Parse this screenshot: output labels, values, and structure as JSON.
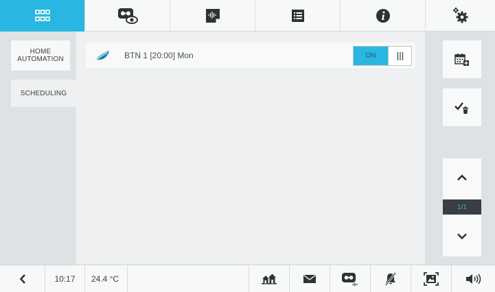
{
  "topbar": {
    "tabs": [
      {
        "icon": "grid-apps-icon",
        "active": true
      },
      {
        "icon": "video-eye-icon",
        "active": false
      },
      {
        "icon": "audio-memo-icon",
        "active": false
      },
      {
        "icon": "list-icon",
        "active": false
      },
      {
        "icon": "info-icon",
        "active": false
      },
      {
        "icon": "settings-gears-icon",
        "active": false
      }
    ]
  },
  "sidebar": {
    "items": [
      {
        "label": "HOME AUTOMATION",
        "selected": false
      },
      {
        "label": "SCHEDULING",
        "selected": true
      }
    ]
  },
  "schedule": {
    "rows": [
      {
        "icon": "leaf-icon",
        "label": "BTN 1 [20:00] Mon",
        "toggle_on_label": "ON",
        "enabled": true
      }
    ]
  },
  "actions": {
    "add_icon": "calendar-add-icon",
    "confirm_delete_icon": "check-trash-icon"
  },
  "pager": {
    "page": "1/1",
    "up_icon": "chevron-up-icon",
    "down_icon": "chevron-down-icon"
  },
  "statusbar": {
    "back_icon": "chevron-left-icon",
    "time": "10:17",
    "temperature": "24.4 °C",
    "icons": [
      "houses-icon",
      "envelope-icon",
      "video-message-icon",
      "mute-bell-icon",
      "fullscreen-frame-icon",
      "speaker-icon"
    ]
  },
  "colors": {
    "accent": "#29b6e0",
    "panel": "#f7f8f8",
    "background": "#eef0f1",
    "sidebar": "#dfe2e4",
    "dark": "#3a3d41"
  }
}
